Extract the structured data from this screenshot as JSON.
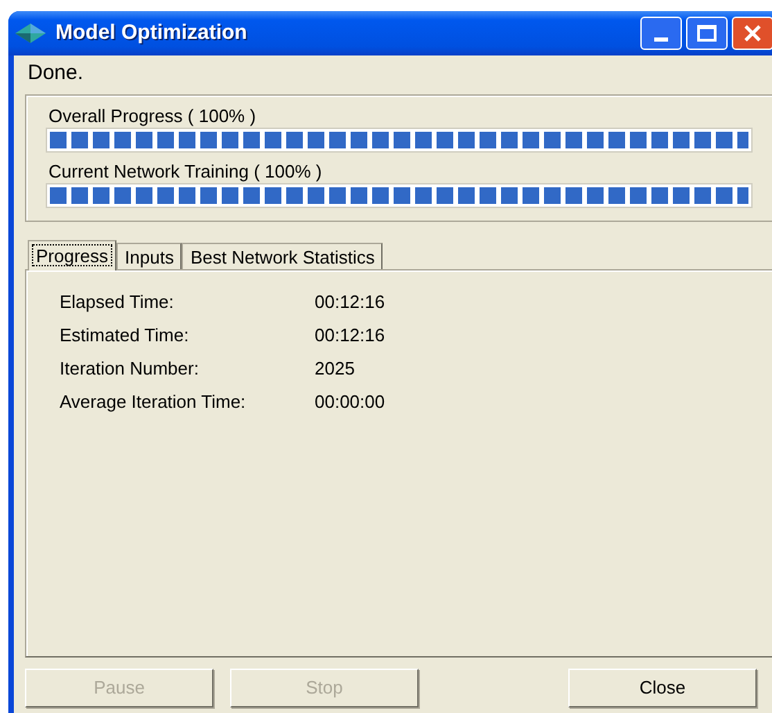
{
  "window": {
    "title": "Model Optimization"
  },
  "status": "Done.",
  "progress_bars": [
    {
      "label": "Overall Progress  ( 100% )",
      "level": 1
    },
    {
      "label": "Current Network Training  ( 100% )",
      "level": 1
    }
  ],
  "tabs": [
    {
      "label": "Progress",
      "selected": true
    },
    {
      "label": "Inputs",
      "selected": false
    },
    {
      "label": "Best Network Statistics",
      "selected": false
    }
  ],
  "stats": [
    {
      "label": "Elapsed Time:",
      "value": "00:12:16"
    },
    {
      "label": "Estimated Time:",
      "value": "00:12:16"
    },
    {
      "label": "Iteration Number:",
      "value": "2025"
    },
    {
      "label": "Average Iteration Time:",
      "value": "00:00:00"
    }
  ],
  "buttons": [
    {
      "label": "Pause",
      "disabled": true
    },
    {
      "label": "Stop",
      "disabled": true
    },
    {
      "label": "Close",
      "disabled": false
    }
  ]
}
